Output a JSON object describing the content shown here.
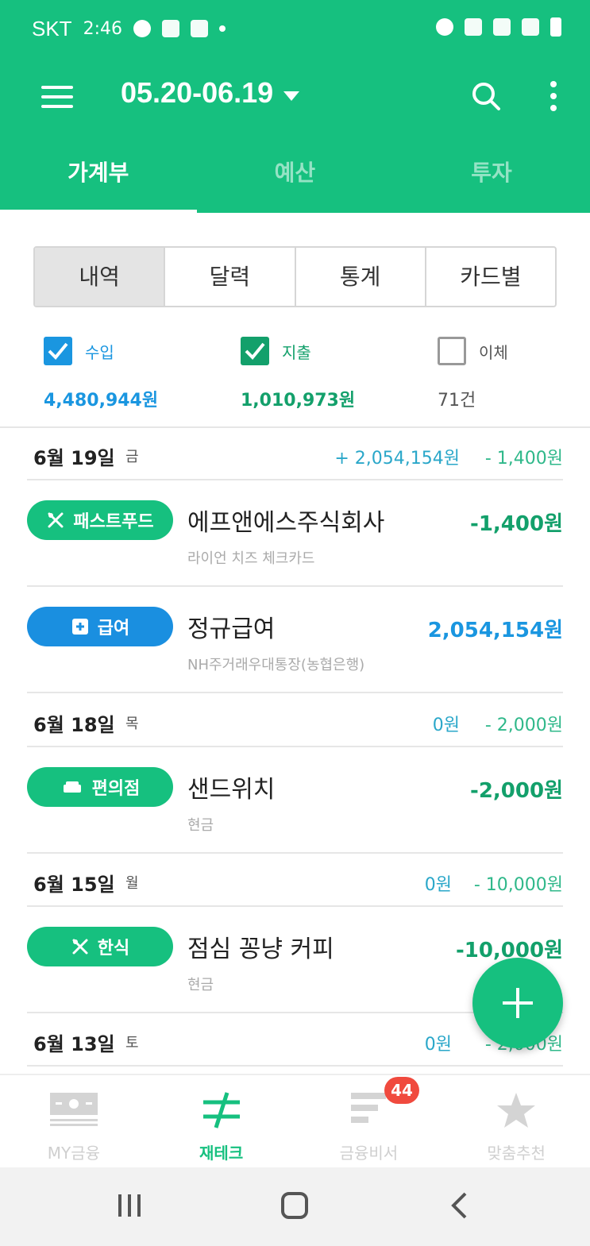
{
  "status_bar": {
    "carrier": "SKT",
    "time": "2:46"
  },
  "header": {
    "date_range": "05.20-06.19"
  },
  "tabs": [
    {
      "label": "가계부",
      "active": true
    },
    {
      "label": "예산",
      "active": false
    },
    {
      "label": "투자",
      "active": false
    }
  ],
  "segments": [
    {
      "label": "내역",
      "active": true
    },
    {
      "label": "달력",
      "active": false
    },
    {
      "label": "통계",
      "active": false
    },
    {
      "label": "카드별",
      "active": false
    }
  ],
  "filters": {
    "income": {
      "label": "수입",
      "amount": "4,480,944원",
      "checked": true
    },
    "expense": {
      "label": "지출",
      "amount": "1,010,973원",
      "checked": true
    },
    "transfer": {
      "label": "이체",
      "amount": "71건",
      "checked": false
    }
  },
  "days": [
    {
      "date": "6월 19일",
      "weekday": "금",
      "income": "+ 2,054,154원",
      "expense": "- 1,400원"
    },
    {
      "date": "6월 18일",
      "weekday": "목",
      "income": "0원",
      "expense": "- 2,000원"
    },
    {
      "date": "6월 15일",
      "weekday": "월",
      "income": "0원",
      "expense": "- 10,000원"
    },
    {
      "date": "6월 13일",
      "weekday": "토",
      "income": "0원",
      "expense": "- 2,000원"
    }
  ],
  "transactions": [
    {
      "category": "패스트푸드",
      "icon": "utensils-icon",
      "merchant": "에프앤에스주식회사",
      "account": "라이언 치즈 체크카드",
      "amount": "-1,400원"
    },
    {
      "category": "급여",
      "icon": "plus-square-icon",
      "merchant": "정규급여",
      "account": "NH주거래우대통장(농협은행)",
      "amount": "2,054,154원"
    },
    {
      "category": "편의점",
      "icon": "sofa-icon",
      "merchant": "샌드위치",
      "account": "현금",
      "amount": "-2,000원"
    },
    {
      "category": "한식",
      "icon": "utensils-icon",
      "merchant": "점심 꽁냥 커피",
      "account": "현금",
      "amount": "-10,000원"
    }
  ],
  "bottom_nav": [
    {
      "label": "MY금융",
      "icon": "money-icon",
      "active": false
    },
    {
      "label": "재테크",
      "icon": "exchange-icon",
      "active": true
    },
    {
      "label": "금융비서",
      "icon": "list-icon",
      "active": false,
      "badge": "44"
    },
    {
      "label": "맞춤추천",
      "icon": "star-icon",
      "active": false
    }
  ],
  "colors": {
    "brand": "#16c07f",
    "income": "#1a96e0",
    "expense": "#13a06b",
    "badge": "#f04a3e"
  }
}
